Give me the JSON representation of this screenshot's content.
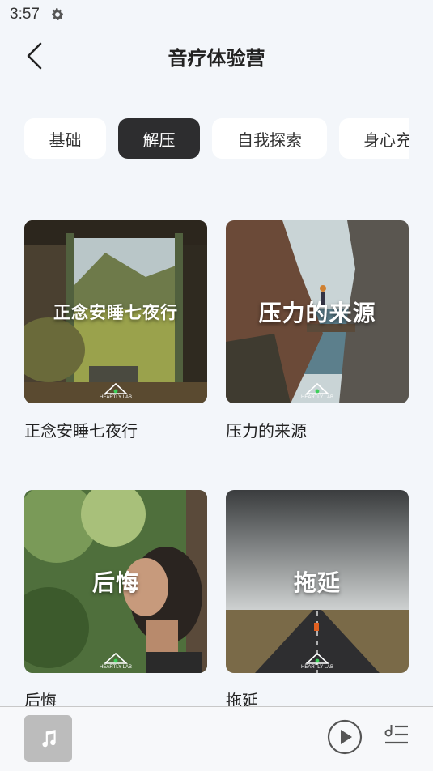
{
  "status_bar": {
    "time": "3:57",
    "settings_icon": "gear-icon"
  },
  "header": {
    "title": "音疗体验营",
    "back_icon": "chevron-left-icon"
  },
  "tabs": [
    {
      "label": "基础",
      "active": false
    },
    {
      "label": "解压",
      "active": true
    },
    {
      "label": "自我探索",
      "active": false
    },
    {
      "label": "身心充",
      "active": false
    }
  ],
  "cards": [
    {
      "overlay_title": "正念安睡七夜行",
      "brand": "HEARTLY LAB",
      "label": "正念安睡七夜行"
    },
    {
      "overlay_title": "压力的来源",
      "brand": "HEARTLY LAB",
      "label": "压力的来源"
    },
    {
      "overlay_title": "后悔",
      "brand": "HEARTLY LAB",
      "label": "后悔"
    },
    {
      "overlay_title": "拖延",
      "brand": "HEARTLY LAB",
      "label": "拖延"
    }
  ],
  "player": {
    "cover_icon": "music-note-icon",
    "play_icon": "play-icon",
    "playlist_icon": "playlist-icon"
  },
  "colors": {
    "background": "#f3f6fa",
    "active_tab": "#2d2d2f",
    "tab": "#ffffff"
  }
}
